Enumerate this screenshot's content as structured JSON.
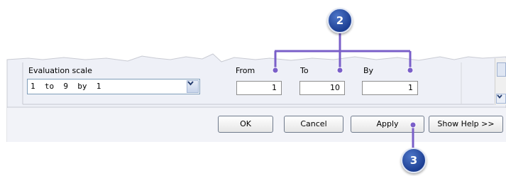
{
  "evaluation_scale": {
    "label": "Evaluation scale",
    "selected": "1  to  9  by  1"
  },
  "fields": {
    "from": {
      "label": "From",
      "value": "1"
    },
    "to": {
      "label": "To",
      "value": "10"
    },
    "by": {
      "label": "By",
      "value": "1"
    }
  },
  "buttons": {
    "ok": "OK",
    "cancel": "Cancel",
    "apply": "Apply",
    "help": "Show Help >>"
  },
  "callouts": {
    "fields": "2",
    "apply": "3"
  },
  "colors": {
    "callout": "#2b4fa6",
    "connector": "#7a5fc9",
    "dialog_bg": "#eef0f7"
  },
  "icons": {
    "dropdown": "chevron-down-icon",
    "scroll_down": "scroll-down-arrow-icon"
  }
}
